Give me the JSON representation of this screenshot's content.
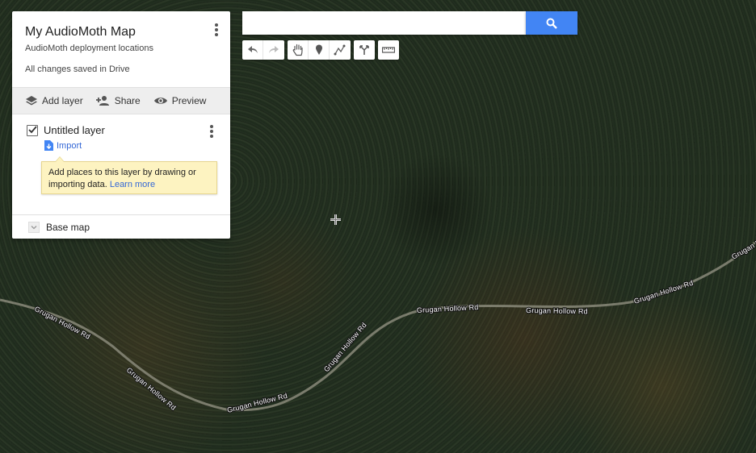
{
  "legend": {
    "title": "My AudioMoth Map",
    "description": "AudioMoth deployment locations",
    "save_status": "All changes saved in Drive",
    "actions": {
      "add_layer": "Add layer",
      "share": "Share",
      "preview": "Preview"
    },
    "layer": {
      "name": "Untitled layer",
      "checked": true,
      "import_label": "Import",
      "tooltip": "Add places to this layer by drawing or importing data.",
      "tooltip_link": "Learn more"
    },
    "base_map_label": "Base map"
  },
  "search": {
    "placeholder": ""
  },
  "tools": [
    "undo-icon",
    "redo-icon",
    "hand-icon",
    "marker-icon",
    "draw-line-icon",
    "directions-icon",
    "ruler-icon"
  ],
  "map": {
    "road_label": "Grugan Hollow Rd"
  },
  "colors": {
    "accent": "#4285f4",
    "link": "#3367d6",
    "tooltip_bg": "#fdf3c1"
  }
}
